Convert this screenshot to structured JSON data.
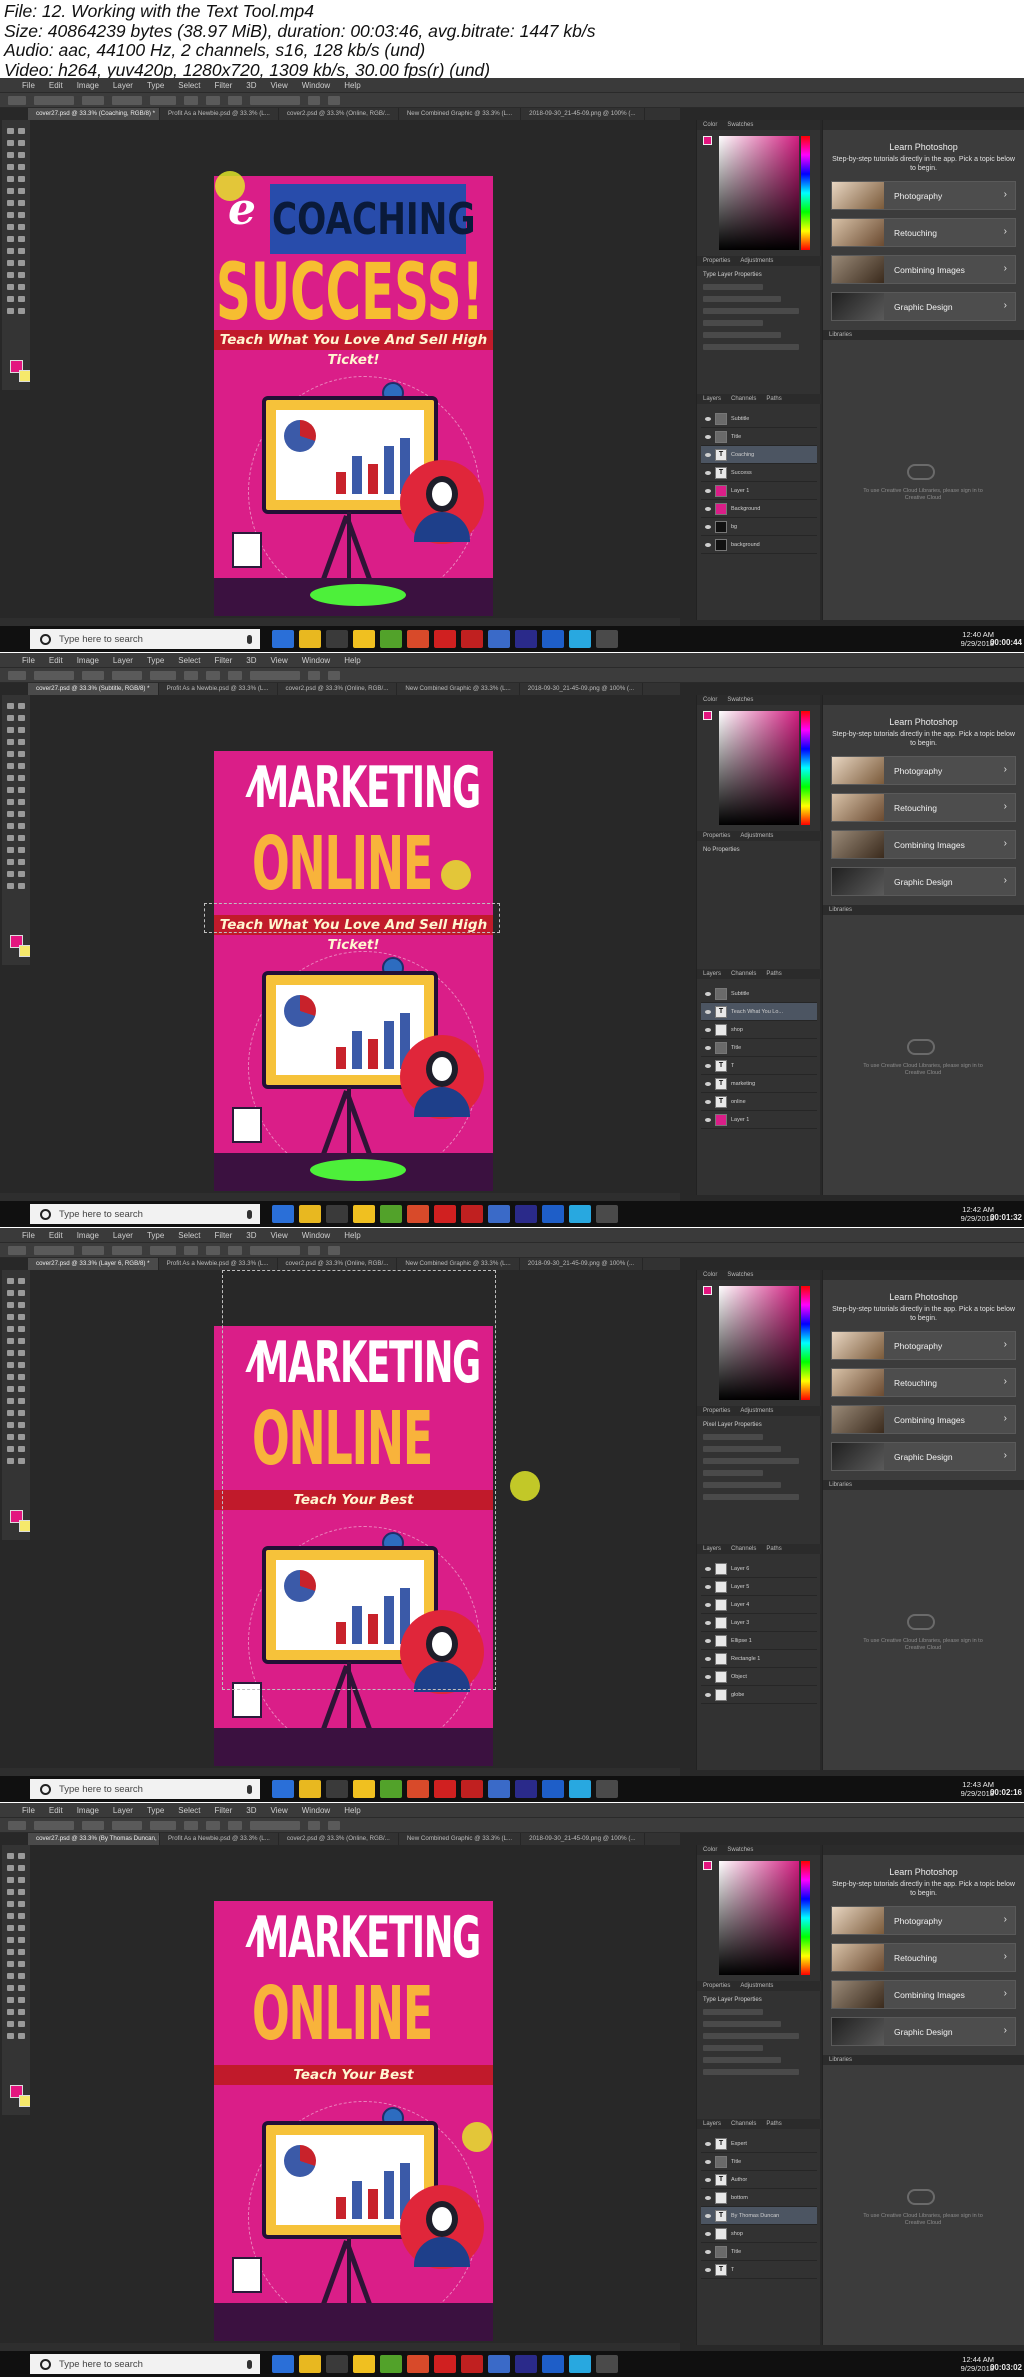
{
  "info": {
    "line1": "File: 12. Working with the Text Tool.mp4",
    "line2": "Size: 40864239 bytes (38.97 MiB), duration: 00:03:46, avg.bitrate: 1447 kb/s",
    "line3": "Audio: aac, 44100 Hz, 2 channels, s16, 128 kb/s (und)",
    "line4": "Video: h264, yuv420p, 1280x720, 1309 kb/s, 30.00 fps(r) (und)"
  },
  "menu": [
    "File",
    "Edit",
    "Image",
    "Layer",
    "Type",
    "Select",
    "Filter",
    "3D",
    "View",
    "Window",
    "Help"
  ],
  "learn": {
    "title": "Learn Photoshop",
    "subtitle": "Step-by-step tutorials directly in the app. Pick a topic below to begin.",
    "items": [
      "Photography",
      "Retouching",
      "Combining Images",
      "Graphic Design"
    ]
  },
  "panels": {
    "color": "Color",
    "swatches": "Swatches",
    "properties": "Properties",
    "adjustments": "Adjustments",
    "layers": "Layers",
    "channels": "Channels",
    "paths": "Paths",
    "libraries": "Libraries",
    "libraries_note": "To use Creative Cloud Libraries, please sign in to Creative Cloud"
  },
  "taskbar": {
    "search_placeholder": "Type here to search"
  },
  "poster": {
    "ribbon_long": "Teach What You Love And Sell High Ticket!",
    "ribbon_short": "Teach Your Best",
    "marketing": "MARKETING",
    "online": "ONLINE",
    "coaching": "COACHING",
    "e": "e",
    "success": "SUCCESS!"
  },
  "frames": [
    {
      "tab_active": "cover27.psd @ 33.3% (Coaching, RGB/8) *",
      "tabs": [
        "cover27.psd @ 33.3% (Coaching, RGB/8) *",
        "Profit As a Newbie.psd @ 33.3% (L...",
        "cover2.psd @ 33.3% (Online, RGB/...",
        "New Combined Graphic @ 33.3% (L...",
        "2018-09-30_21-45-09.png @ 100% (..."
      ],
      "properties_title": "Type Layer Properties",
      "time": "12:40 AM",
      "date": "9/29/2018",
      "timecode": "00:00:44",
      "layers": [
        "Subtitle",
        "Title",
        "Coaching",
        "Success",
        "Layer 1",
        "Background",
        "bg",
        "background"
      ]
    },
    {
      "tab_active": "cover27.psd @ 33.3% (Subtitle, RGB/8) *",
      "tabs": [
        "cover27.psd @ 33.3% (Subtitle, RGB/8) *",
        "Profit As a Newbie.psd @ 33.3% (L...",
        "cover2.psd @ 33.3% (Online, RGB/...",
        "New Combined Graphic @ 33.3% (L...",
        "2018-09-30_21-45-09.png @ 100% (..."
      ],
      "properties_title": "No Properties",
      "time": "12:42 AM",
      "date": "9/29/2018",
      "timecode": "00:01:32",
      "layers": [
        "Subtitle",
        "Teach What You Lo...",
        "shop",
        "Title",
        "T",
        "marketing",
        "online",
        "Layer 1"
      ]
    },
    {
      "tab_active": "cover27.psd @ 33.3% (Layer 6, RGB/8) *",
      "tabs": [
        "cover27.psd @ 33.3% (Layer 6, RGB/8) *",
        "Profit As a Newbie.psd @ 33.3% (L...",
        "cover2.psd @ 33.3% (Online, RGB/...",
        "New Combined Graphic @ 33.3% (L...",
        "2018-09-30_21-45-09.png @ 100% (..."
      ],
      "properties_title": "Pixel Layer Properties",
      "time": "12:43 AM",
      "date": "9/29/2018",
      "timecode": "00:02:16",
      "layers": [
        "Layer 6",
        "Layer 5",
        "Layer 4",
        "Layer 3",
        "Ellipse 1",
        "Rectangle 1",
        "Object",
        "globe"
      ]
    },
    {
      "tab_active": "cover27.psd @ 33.3% (By Thomas Duncan, RGB/8) *",
      "tabs": [
        "cover27.psd @ 33.3% (By Thomas Duncan, RGB/8) *",
        "Profit As a Newbie.psd @ 33.3% (L...",
        "cover2.psd @ 33.3% (Online, RGB/...",
        "New Combined Graphic @ 33.3% (L...",
        "2018-09-30_21-45-09.png @ 100% (..."
      ],
      "properties_title": "Type Layer Properties",
      "time": "12:44 AM",
      "date": "9/29/2018",
      "timecode": "00:03:02",
      "layers": [
        "Expert",
        "Title",
        "Author",
        "bottom",
        "By Thomas Duncan",
        "shop",
        "Title",
        "T"
      ]
    }
  ],
  "colors": {
    "poster_pink": "#da1e88",
    "headline_orange": "#f8b33b",
    "ribbon_red": "#c11a2b",
    "cursor_yellow": "#e4ec28"
  }
}
